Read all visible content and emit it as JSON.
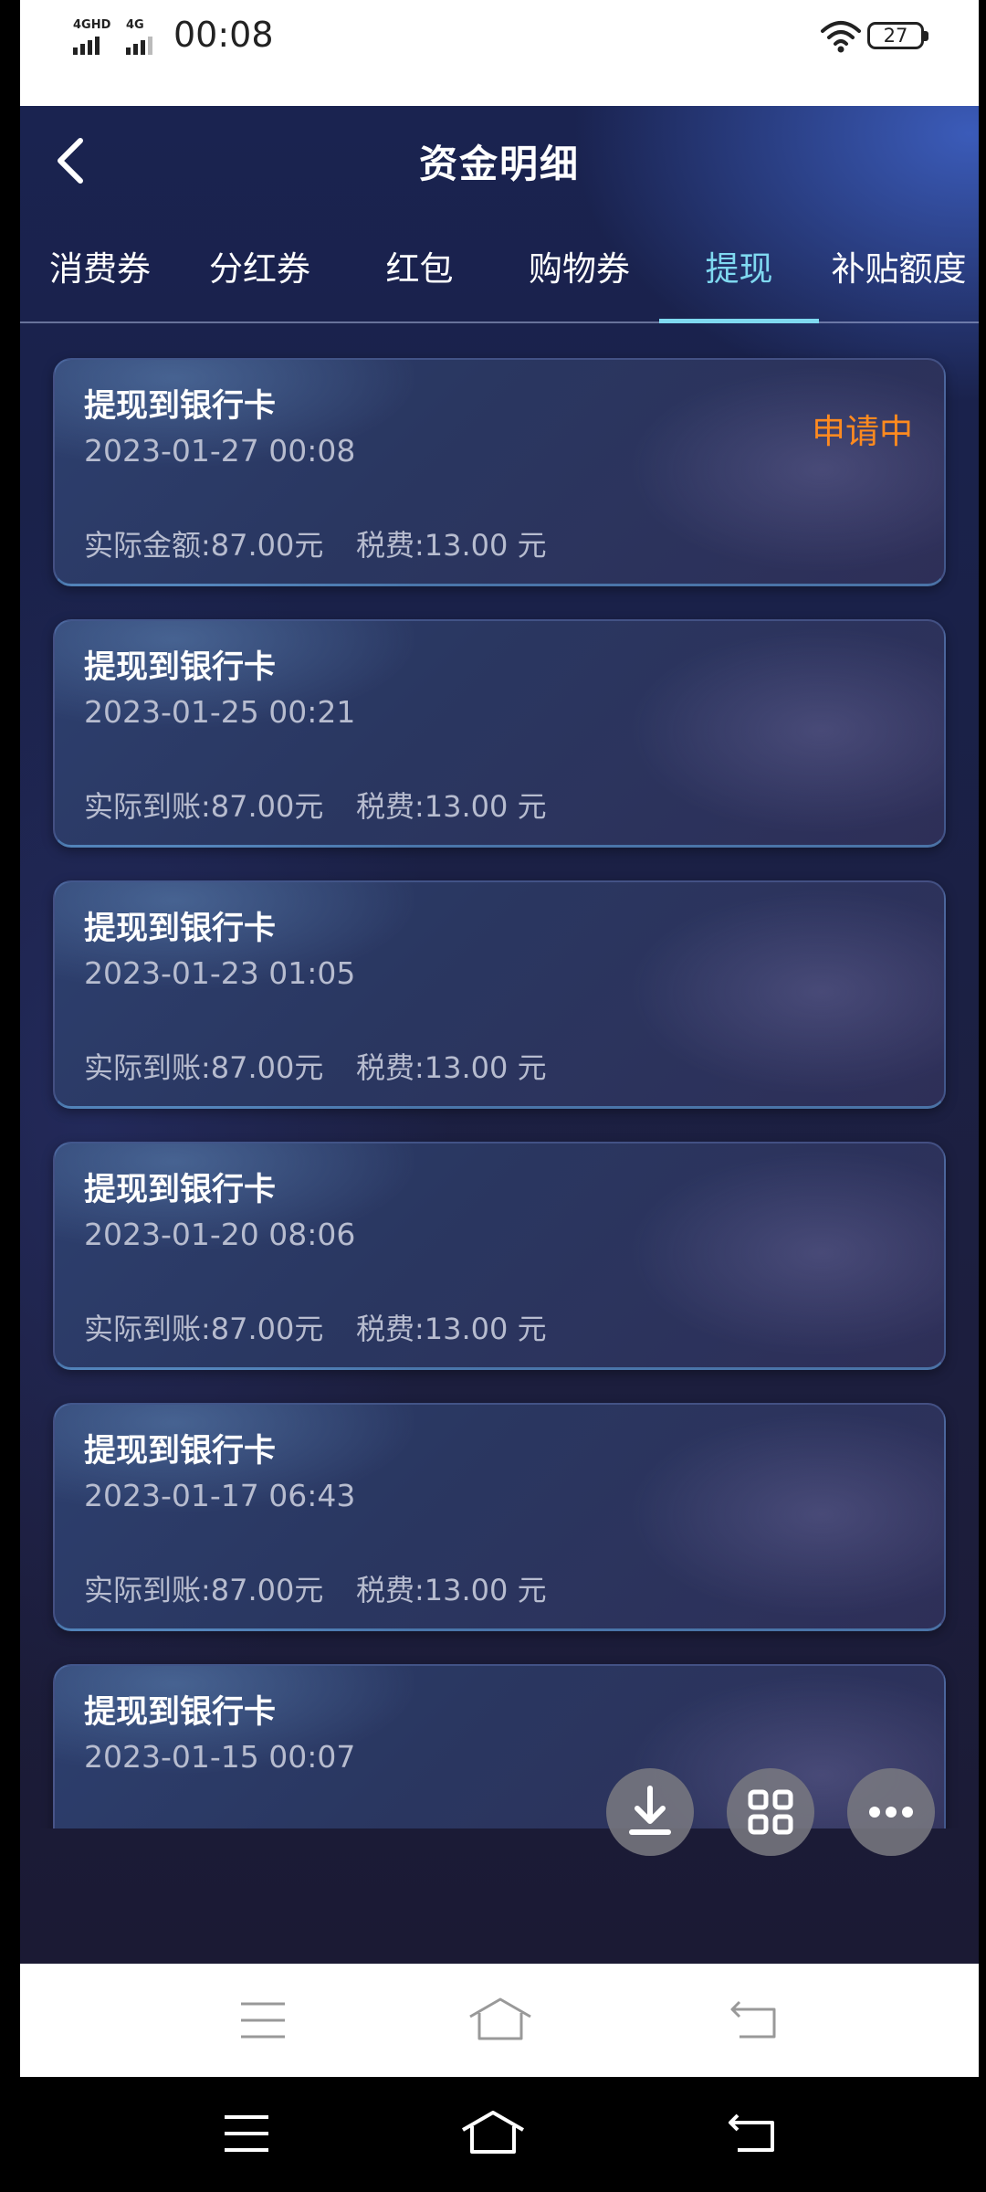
{
  "status_bar": {
    "sim1_label": "4GHD",
    "sim2_label": "4G",
    "time": "00:08",
    "battery": "27"
  },
  "header": {
    "title": "资金明细"
  },
  "tabs": [
    {
      "label": "消费券",
      "active": false
    },
    {
      "label": "分红券",
      "active": false
    },
    {
      "label": "红包",
      "active": false
    },
    {
      "label": "购物券",
      "active": false
    },
    {
      "label": "提现",
      "active": true
    },
    {
      "label": "补贴额度",
      "active": false
    }
  ],
  "records": [
    {
      "title": "提现到银行卡",
      "time": "2023-01-27 00:08",
      "amount": "实际金额:87.00元",
      "tax": "税费:13.00 元",
      "status": "申请中"
    },
    {
      "title": "提现到银行卡",
      "time": "2023-01-25 00:21",
      "amount": "实际到账:87.00元",
      "tax": "税费:13.00 元",
      "status": ""
    },
    {
      "title": "提现到银行卡",
      "time": "2023-01-23 01:05",
      "amount": "实际到账:87.00元",
      "tax": "税费:13.00 元",
      "status": ""
    },
    {
      "title": "提现到银行卡",
      "time": "2023-01-20 08:06",
      "amount": "实际到账:87.00元",
      "tax": "税费:13.00 元",
      "status": ""
    },
    {
      "title": "提现到银行卡",
      "time": "2023-01-17 06:43",
      "amount": "实际到账:87.00元",
      "tax": "税费:13.00 元",
      "status": ""
    },
    {
      "title": "提现到银行卡",
      "time": "2023-01-15 00:07",
      "amount": "",
      "tax": "",
      "status": ""
    }
  ],
  "floating_buttons": [
    "download-icon",
    "grid-icon",
    "more-icon"
  ],
  "colors": {
    "accent": "#7fd9f0",
    "status_pending": "#ff8a1f"
  }
}
